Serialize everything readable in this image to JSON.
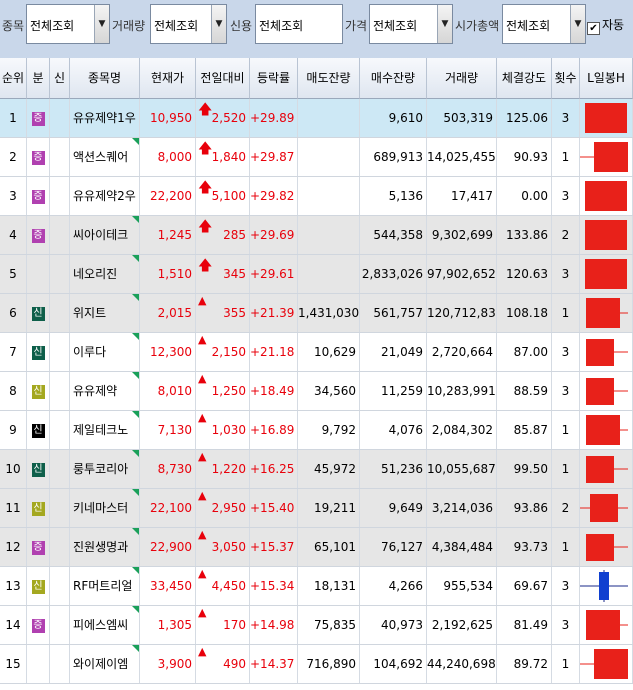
{
  "filters": [
    {
      "label": "종목",
      "value": "전체조회"
    },
    {
      "label": "거래량",
      "value": "전체조회"
    },
    {
      "label": "신용",
      "value": "전체조회"
    },
    {
      "label": "가격",
      "value": "전체조회"
    },
    {
      "label": "시가총액",
      "value": "전체조회"
    }
  ],
  "auto": {
    "label": "자동",
    "checked": true
  },
  "columns": [
    "순위",
    "분",
    "신",
    "종목명",
    "현재가",
    "전일대비",
    "등락률",
    "매도잔량",
    "매수잔량",
    "거래량",
    "체결강도",
    "횟수",
    "L일봉H"
  ],
  "badge_colors": {
    "증": "#b040b0",
    "신": "#0e5f4a",
    "신-lime": "#a4a820",
    "신-black": "#000000"
  },
  "rows": [
    {
      "rank": "1",
      "badge": "증",
      "badge_color": "#b040b0",
      "name": "유유제약1우",
      "price": "10,950",
      "arrow": "up-bold",
      "change": "2,520",
      "rate": "+29.89",
      "ask": "",
      "bid": "9,610",
      "volume": "503,319",
      "strength": "125.06",
      "count": "3",
      "bg": "#cde8f5",
      "candle": {
        "type": "full",
        "color": "#e8211a"
      }
    },
    {
      "rank": "2",
      "badge": "증",
      "badge_color": "#b040b0",
      "name": "액션스퀘어",
      "price": "8,000",
      "arrow": "up-bold",
      "change": "1,840",
      "rate": "+29.87",
      "ask": "",
      "bid": "689,913",
      "volume": "14,025,455",
      "strength": "90.93",
      "count": "1",
      "bg": "#ffffff",
      "candle": {
        "type": "wick-left",
        "color": "#e8211a"
      }
    },
    {
      "rank": "3",
      "badge": "증",
      "badge_color": "#b040b0",
      "name": "유유제약2우",
      "price": "22,200",
      "arrow": "up-bold",
      "change": "5,100",
      "rate": "+29.82",
      "ask": "",
      "bid": "5,136",
      "volume": "17,417",
      "strength": "0.00",
      "count": "3",
      "bg": "#ffffff",
      "candle": {
        "type": "full",
        "color": "#e8211a"
      }
    },
    {
      "rank": "4",
      "badge": "증",
      "badge_color": "#b040b0",
      "name": "씨아이테크",
      "price": "1,245",
      "arrow": "up-bold",
      "change": "285",
      "rate": "+29.69",
      "ask": "",
      "bid": "544,358",
      "volume": "9,302,699",
      "strength": "133.86",
      "count": "2",
      "bg": "#e6e6e6",
      "candle": {
        "type": "full",
        "color": "#e8211a"
      }
    },
    {
      "rank": "5",
      "badge": "",
      "badge_color": "",
      "name": "네오리진",
      "price": "1,510",
      "arrow": "up-bold",
      "change": "345",
      "rate": "+29.61",
      "ask": "",
      "bid": "2,833,026",
      "volume": "97,902,652",
      "strength": "120.63",
      "count": "3",
      "bg": "#e6e6e6",
      "candle": {
        "type": "full",
        "color": "#e8211a"
      }
    },
    {
      "rank": "6",
      "badge": "신",
      "badge_color": "#0e5f4a",
      "name": "위지트",
      "price": "2,015",
      "arrow": "up",
      "change": "355",
      "rate": "+21.39",
      "ask": "1,431,030",
      "bid": "561,757",
      "volume": "120,712,833",
      "strength": "108.18",
      "count": "1",
      "bg": "#e6e6e6",
      "candle": {
        "type": "wick-right",
        "color": "#e8211a"
      }
    },
    {
      "rank": "7",
      "badge": "신",
      "badge_color": "#0e5f4a",
      "name": "이루다",
      "price": "12,300",
      "arrow": "up",
      "change": "2,150",
      "rate": "+21.18",
      "ask": "10,629",
      "bid": "21,049",
      "volume": "2,720,664",
      "strength": "87.00",
      "count": "3",
      "bg": "#ffffff",
      "candle": {
        "type": "wick-right-long",
        "color": "#e8211a"
      }
    },
    {
      "rank": "8",
      "badge": "신",
      "badge_color": "#a4a820",
      "name": "유유제약",
      "price": "8,010",
      "arrow": "up",
      "change": "1,250",
      "rate": "+18.49",
      "ask": "34,560",
      "bid": "11,259",
      "volume": "10,283,991",
      "strength": "88.59",
      "count": "3",
      "bg": "#ffffff",
      "candle": {
        "type": "wick-right-long",
        "color": "#e8211a"
      }
    },
    {
      "rank": "9",
      "badge": "신",
      "badge_color": "#000000",
      "name": "제일테크노",
      "price": "7,130",
      "arrow": "up",
      "change": "1,030",
      "rate": "+16.89",
      "ask": "9,792",
      "bid": "4,076",
      "volume": "2,084,302",
      "strength": "85.87",
      "count": "1",
      "bg": "#ffffff",
      "candle": {
        "type": "wick-right",
        "color": "#e8211a"
      }
    },
    {
      "rank": "10",
      "badge": "신",
      "badge_color": "#0e5f4a",
      "name": "룽투코리아",
      "price": "8,730",
      "arrow": "up",
      "change": "1,220",
      "rate": "+16.25",
      "ask": "45,972",
      "bid": "51,236",
      "volume": "10,055,687",
      "strength": "99.50",
      "count": "1",
      "bg": "#e6e6e6",
      "candle": {
        "type": "wick-right-long",
        "color": "#e8211a"
      }
    },
    {
      "rank": "11",
      "badge": "신",
      "badge_color": "#a4a820",
      "name": "키네마스터",
      "price": "22,100",
      "arrow": "up",
      "change": "2,950",
      "rate": "+15.40",
      "ask": "19,211",
      "bid": "9,649",
      "volume": "3,214,036",
      "strength": "93.86",
      "count": "2",
      "bg": "#e6e6e6",
      "candle": {
        "type": "cross",
        "color": "#e8211a"
      }
    },
    {
      "rank": "12",
      "badge": "증",
      "badge_color": "#b040b0",
      "name": "진원생명과",
      "price": "22,900",
      "arrow": "up",
      "change": "3,050",
      "rate": "+15.37",
      "ask": "65,101",
      "bid": "76,127",
      "volume": "4,384,484",
      "strength": "93.73",
      "count": "1",
      "bg": "#e6e6e6",
      "candle": {
        "type": "wick-right-long",
        "color": "#e8211a"
      }
    },
    {
      "rank": "13",
      "badge": "신",
      "badge_color": "#a4a820",
      "name": "RF머트리얼",
      "price": "33,450",
      "arrow": "up",
      "change": "4,450",
      "rate": "+15.34",
      "ask": "18,131",
      "bid": "4,266",
      "volume": "955,534",
      "strength": "69.67",
      "count": "3",
      "bg": "#ffffff",
      "candle": {
        "type": "blue-cross",
        "color": "#1040d0"
      }
    },
    {
      "rank": "14",
      "badge": "증",
      "badge_color": "#b040b0",
      "name": "피에스엠씨",
      "price": "1,305",
      "arrow": "up",
      "change": "170",
      "rate": "+14.98",
      "ask": "75,835",
      "bid": "40,973",
      "volume": "2,192,625",
      "strength": "81.49",
      "count": "3",
      "bg": "#ffffff",
      "candle": {
        "type": "wick-right",
        "color": "#e8211a"
      }
    },
    {
      "rank": "15",
      "badge": "",
      "badge_color": "",
      "name": "와이제이엠",
      "price": "3,900",
      "arrow": "up",
      "change": "490",
      "rate": "+14.37",
      "ask": "716,890",
      "bid": "104,692",
      "volume": "44,240,698",
      "strength": "89.72",
      "count": "1",
      "bg": "#ffffff",
      "candle": {
        "type": "wick-left",
        "color": "#e8211a"
      }
    }
  ]
}
